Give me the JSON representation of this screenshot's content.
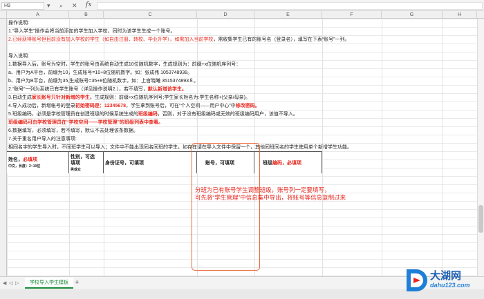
{
  "formula_bar": {
    "cell_ref": "H9",
    "fx": "fx"
  },
  "columns": [
    "A",
    "B",
    "C",
    "D",
    "E",
    "F",
    "G",
    "H"
  ],
  "instructions": [
    {
      "segs": [
        {
          "t": "操作说明:"
        }
      ]
    },
    {
      "segs": [
        {
          "t": "1.“导入学生”操作会将当前添加的学生加入学校，同时为该学生生成一个账号。"
        }
      ]
    },
    {
      "segs": [
        {
          "t": "2.已经获得账号但目前没有加入学校的学生（如自由注册、转校、毕业升学），如需加入当前学校",
          "c": "red"
        },
        {
          "t": "，需收集学生已有的账号名（登录名），填写在下表“账号”一列。"
        }
      ]
    },
    {
      "segs": [
        {
          "t": ""
        }
      ]
    },
    {
      "segs": [
        {
          "t": "导入说明:"
        }
      ]
    },
    {
      "segs": [
        {
          "t": "1.数据导入后，账号为空时，学生的账号由系统自动生成10位随机数字，生成规则为：前缀+x位随机序列号："
        }
      ]
    },
    {
      "segs": [
        {
          "t": "a、用户为A平台，前缀为10，生成账号=10+8位随机数字。如：张成伟 1053748938。"
        }
      ]
    },
    {
      "segs": [
        {
          "t": "b、用户为B平台，前缀为35,生成账号=35+8位随机数字。如：上官晓曦 3515374893８。"
        }
      ]
    },
    {
      "segs": [
        {
          "t": "2.“账号”一列为系统已有学生账号（详见操作说明2.），若不填写，"
        },
        {
          "t": "默认新增该学生。",
          "c": "red bold"
        }
      ]
    },
    {
      "segs": [
        {
          "t": "3.自动生成"
        },
        {
          "t": "家长账号只针对新增的学生",
          "c": "red bold"
        },
        {
          "t": "。生成规则：前缀+x位随机序列号;学生家长姓名为:学生名称+(父亲/母亲)。"
        }
      ]
    },
    {
      "segs": [
        {
          "t": "4.导入成功后，新增帐号的登录"
        },
        {
          "t": "初始密码是：12345678",
          "c": "red bold"
        },
        {
          "t": "，学生拿到账号后，可在“个人空间——用户中心”中"
        },
        {
          "t": "修改密码。",
          "c": "red bold"
        }
      ]
    },
    {
      "segs": [
        {
          "t": "5.班级编码，必须是学校管理员在创建班级的时候系统生成的"
        },
        {
          "t": "班级编码",
          "c": "red bold"
        },
        {
          "t": "，否则，对于没有班级编码或无效的班级编码用户，该值不导入。"
        }
      ]
    },
    {
      "segs": [
        {
          "t": "   班级编码可由学校管理员在“学校空间——学校管理”的班级列表中查看。",
          "c": "red bold"
        }
      ]
    },
    {
      "segs": [
        {
          "t": "6.数据填写，必须填写，若不填写，默认不去处理该条数据。"
        }
      ]
    },
    {
      "segs": [
        {
          "t": "7.关于重名用户导入的注意事项:"
        }
      ]
    },
    {
      "segs": [
        {
          "t": "相同名字的学生导入时，不同班学生可以导入；文件中不能出现同名同班的学生，如存在请在导入文件中保留一个，其他同班同名的学生使用单个新增学生功能。"
        }
      ]
    }
  ],
  "table_header": {
    "name": "姓名，",
    "name_req": "必填项",
    "name_sub": "中文，长度：2~10位",
    "gender": "性别，可选",
    "gender2": "填项",
    "gender_sub": "男或女",
    "id_card": "身份证号，可填项",
    "account": "账号，可填项",
    "class_code_pre": "班级",
    "class_code": "编码",
    "class_code_post": "，必填项"
  },
  "callout": {
    "line1": "分班为已有账号学生调整班级，账号列一定要填写，",
    "line2": "可先将“学生管理”中信息集中导出，将账号等信息复制过来"
  },
  "sheet_tabs": {
    "active": "学校导入学生模板",
    "add": "+"
  },
  "watermark": {
    "brand": "大湖网",
    "url": "dahu123.com"
  },
  "colors": {
    "red": "#e8281f",
    "green_tab": "#1a8a3a",
    "annotation_border": "#ea6a3c"
  }
}
